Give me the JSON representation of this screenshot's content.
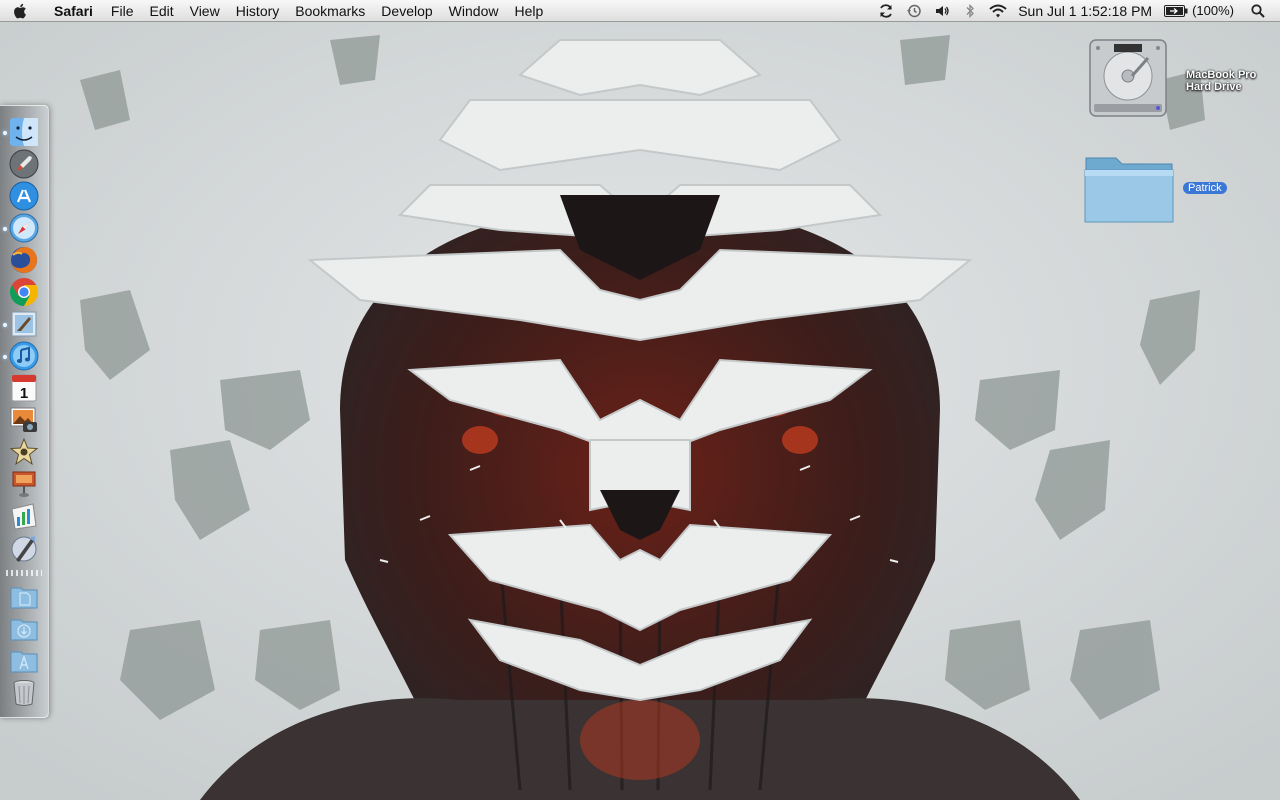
{
  "menubar": {
    "apple_icon": "apple-icon",
    "app_name": "Safari",
    "menus": [
      "File",
      "Edit",
      "View",
      "History",
      "Bookmarks",
      "Develop",
      "Window",
      "Help"
    ],
    "status_icons": [
      "sync-icon",
      "time-machine-icon",
      "volume-icon",
      "bluetooth-icon",
      "wifi-icon"
    ],
    "clock": "Sun Jul 1  1:52:18 PM",
    "battery": "(100%)",
    "spotlight_icon": "spotlight-search-icon"
  },
  "desktop": {
    "hard_drive_label_line1": "MacBook Pro",
    "hard_drive_label_line2": "Hard Drive",
    "folder_label": "Patrick"
  },
  "dock": {
    "running_apps": [
      "finder",
      "safari",
      "mail",
      "itunes"
    ],
    "apps": [
      "finder-icon",
      "launchpad-icon",
      "app-store-icon",
      "safari-icon",
      "firefox-icon",
      "chrome-icon",
      "mail-icon",
      "itunes-icon",
      "calendar-icon",
      "iphoto-icon",
      "imovie-icon",
      "keynote-icon",
      "numbers-icon",
      "xcode-icon"
    ],
    "calendar_day": "1",
    "stacks": [
      "documents-stack-icon",
      "downloads-stack-icon",
      "applications-stack-icon",
      "trash-icon"
    ]
  }
}
